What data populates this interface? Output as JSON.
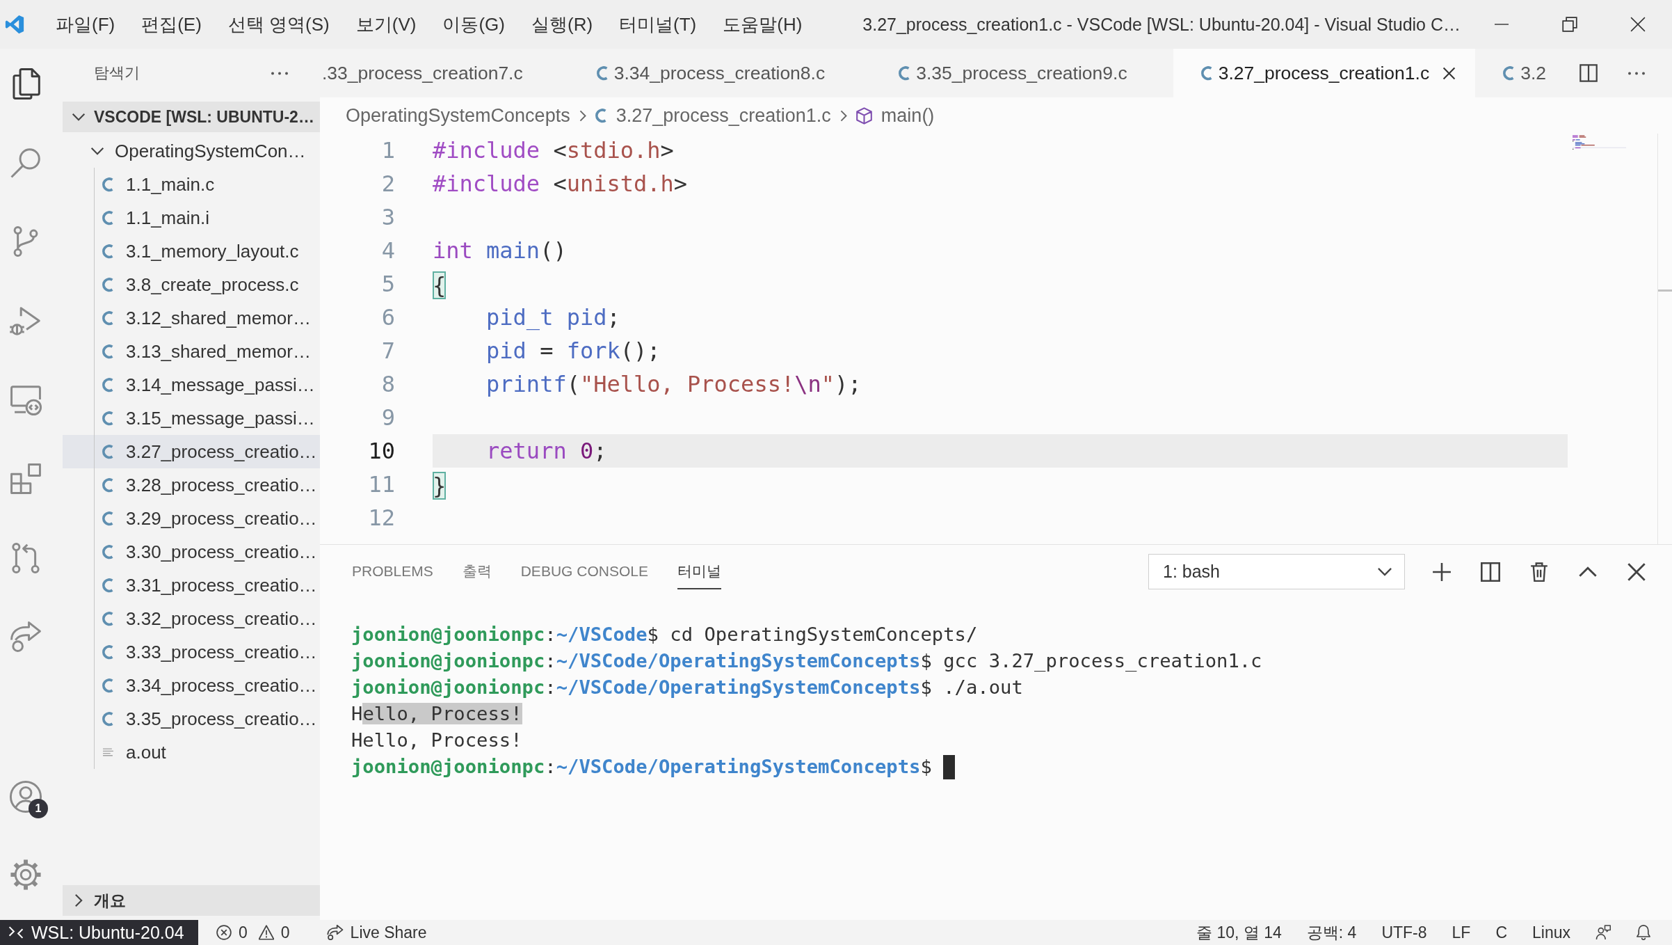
{
  "window": {
    "title": "3.27_process_creation1.c - VSCode [WSL: Ubuntu-20.04] - Visual Studio C…"
  },
  "menu": [
    "파일(F)",
    "편집(E)",
    "선택 영역(S)",
    "보기(V)",
    "이동(G)",
    "실행(R)",
    "터미널(T)",
    "도움말(H)"
  ],
  "activity_bar": {
    "items": [
      {
        "kind": "explorer",
        "selected": true
      },
      {
        "kind": "search",
        "selected": false
      },
      {
        "kind": "source_control",
        "selected": false
      },
      {
        "kind": "run_debug",
        "selected": false
      },
      {
        "kind": "remote",
        "selected": false
      },
      {
        "kind": "extensions",
        "selected": false
      },
      {
        "kind": "pull_requests",
        "selected": false
      },
      {
        "kind": "live_share",
        "selected": false
      }
    ],
    "bottom": [
      {
        "kind": "accounts",
        "badge": "1"
      },
      {
        "kind": "settings"
      }
    ]
  },
  "sidebar": {
    "title": "탐색기",
    "sections": [
      {
        "title": "VSCODE [WSL: UBUNTU-2…",
        "expanded": true,
        "children": [
          {
            "name": "OperatingSystemCon…",
            "kind": "folder",
            "expanded": true,
            "selected": false,
            "children": [
              {
                "name": "1.1_main.c",
                "kind": "c",
                "selected": false
              },
              {
                "name": "1.1_main.i",
                "kind": "c",
                "selected": false
              },
              {
                "name": "3.1_memory_layout.c",
                "kind": "c",
                "selected": false
              },
              {
                "name": "3.8_create_process.c",
                "kind": "c",
                "selected": false
              },
              {
                "name": "3.12_shared_memor…",
                "kind": "c",
                "selected": false
              },
              {
                "name": "3.13_shared_memor…",
                "kind": "c",
                "selected": false
              },
              {
                "name": "3.14_message_passi…",
                "kind": "c",
                "selected": false
              },
              {
                "name": "3.15_message_passi…",
                "kind": "c",
                "selected": false
              },
              {
                "name": "3.27_process_creatio…",
                "kind": "c",
                "selected": true
              },
              {
                "name": "3.28_process_creatio…",
                "kind": "c",
                "selected": false
              },
              {
                "name": "3.29_process_creatio…",
                "kind": "c",
                "selected": false
              },
              {
                "name": "3.30_process_creatio…",
                "kind": "c",
                "selected": false
              },
              {
                "name": "3.31_process_creatio…",
                "kind": "c",
                "selected": false
              },
              {
                "name": "3.32_process_creatio…",
                "kind": "c",
                "selected": false
              },
              {
                "name": "3.33_process_creatio…",
                "kind": "c",
                "selected": false
              },
              {
                "name": "3.34_process_creatio…",
                "kind": "c",
                "selected": false
              },
              {
                "name": "3.35_process_creatio…",
                "kind": "c",
                "selected": false
              },
              {
                "name": "a.out",
                "kind": "file",
                "selected": false
              }
            ]
          }
        ]
      },
      {
        "title": "개요",
        "expanded": false
      }
    ]
  },
  "editor": {
    "tabs": [
      {
        "label": ".33_process_creation7.c",
        "kind": "clipped",
        "selected": false
      },
      {
        "label": "3.34_process_creation8.c",
        "kind": "c",
        "selected": false
      },
      {
        "label": "3.35_process_creation9.c",
        "kind": "c",
        "selected": false
      },
      {
        "label": "3.27_process_creation1.c",
        "kind": "c",
        "selected": true
      },
      {
        "label": "3.2",
        "kind": "c",
        "selected": false
      }
    ],
    "breadcrumb": [
      {
        "text": "OperatingSystemConcepts",
        "kind": "folder"
      },
      {
        "text": "3.27_process_creation1.c",
        "kind": "c"
      },
      {
        "text": "main()",
        "kind": "symbol"
      }
    ],
    "lines": [
      {
        "number": "1",
        "current": false,
        "tokens": [
          {
            "kind": "directive",
            "text": "#include"
          },
          {
            "kind": "plain",
            "text": " <"
          },
          {
            "kind": "header",
            "text": "stdio.h"
          },
          {
            "kind": "plain",
            "text": ">"
          }
        ]
      },
      {
        "number": "2",
        "current": false,
        "tokens": [
          {
            "kind": "directive",
            "text": "#include"
          },
          {
            "kind": "plain",
            "text": " <"
          },
          {
            "kind": "header",
            "text": "unistd.h"
          },
          {
            "kind": "plain",
            "text": ">"
          }
        ]
      },
      {
        "number": "3",
        "current": false
      },
      {
        "number": "4",
        "current": false,
        "tokens": [
          {
            "kind": "keyword",
            "text": "int"
          },
          {
            "kind": "function",
            "text": " main"
          },
          {
            "kind": "plain",
            "text": "()"
          }
        ]
      },
      {
        "number": "5",
        "current": false,
        "tokens": [
          {
            "kind": "bracket_match",
            "text": "{"
          }
        ]
      },
      {
        "number": "6",
        "current": false,
        "tokens": [
          {
            "kind": "type",
            "text": "    pid_t"
          },
          {
            "kind": "variable",
            "text": " pid"
          },
          {
            "kind": "plain",
            "text": ";"
          }
        ]
      },
      {
        "number": "7",
        "current": false,
        "tokens": [
          {
            "kind": "variable",
            "text": "    pid"
          },
          {
            "kind": "plain",
            "text": " = "
          },
          {
            "kind": "function",
            "text": "fork"
          },
          {
            "kind": "plain",
            "text": "();"
          }
        ]
      },
      {
        "number": "8",
        "current": false,
        "tokens": [
          {
            "kind": "function",
            "text": "    printf"
          },
          {
            "kind": "plain",
            "text": "("
          },
          {
            "kind": "string",
            "text": "\"Hello, Process!"
          },
          {
            "kind": "escape",
            "text": "\\n"
          },
          {
            "kind": "string",
            "text": "\""
          },
          {
            "kind": "plain",
            "text": ");"
          }
        ]
      },
      {
        "number": "9",
        "current": false
      },
      {
        "number": "10",
        "current": true,
        "tokens": [
          {
            "kind": "keyword",
            "text": "    return"
          },
          {
            "kind": "number",
            "text": " 0"
          },
          {
            "kind": "plain",
            "text": ";"
          }
        ]
      },
      {
        "number": "11",
        "current": false,
        "tokens": [
          {
            "kind": "bracket_match",
            "text": "}"
          }
        ]
      },
      {
        "number": "12",
        "current": false
      }
    ]
  },
  "panel": {
    "tabs": [
      {
        "label": "PROBLEMS",
        "selected": false
      },
      {
        "label": "출력",
        "selected": false
      },
      {
        "label": "DEBUG CONSOLE",
        "selected": false
      },
      {
        "label": "터미널",
        "selected": true
      }
    ],
    "terminal_picker": "1: bash",
    "terminal": [
      {
        "cursor": false,
        "segments": [
          {
            "kind": "user",
            "text": "joonion@joonionpc"
          },
          {
            "kind": "plain",
            "text": ":"
          },
          {
            "kind": "path",
            "text": "~/VSCode"
          },
          {
            "kind": "plain",
            "text": "$ cd OperatingSystemConcepts/"
          }
        ]
      },
      {
        "cursor": false,
        "segments": [
          {
            "kind": "user",
            "text": "joonion@joonionpc"
          },
          {
            "kind": "plain",
            "text": ":"
          },
          {
            "kind": "path",
            "text": "~/VSCode/OperatingSystemConcepts"
          },
          {
            "kind": "plain",
            "text": "$ gcc 3.27_process_creation1.c"
          }
        ]
      },
      {
        "cursor": false,
        "segments": [
          {
            "kind": "user",
            "text": "joonion@joonionpc"
          },
          {
            "kind": "plain",
            "text": ":"
          },
          {
            "kind": "path",
            "text": "~/VSCode/OperatingSystemConcepts"
          },
          {
            "kind": "plain",
            "text": "$ ./a.out"
          }
        ]
      },
      {
        "cursor": false,
        "segments": [
          {
            "kind": "plain",
            "text": "H"
          },
          {
            "kind": "selection",
            "text": "ello, Process!"
          }
        ]
      },
      {
        "cursor": false,
        "segments": [
          {
            "kind": "plain",
            "text": "Hello, Process!"
          }
        ]
      },
      {
        "cursor": true,
        "segments": [
          {
            "kind": "user",
            "text": "joonion@joonionpc"
          },
          {
            "kind": "plain",
            "text": ":"
          },
          {
            "kind": "path",
            "text": "~/VSCode/OperatingSystemConcepts"
          },
          {
            "kind": "plain",
            "text": "$"
          }
        ]
      }
    ]
  },
  "status_bar": {
    "remote": "WSL: Ubuntu-20.04",
    "errors": "0",
    "warnings": "0",
    "live_share": "Live Share",
    "items": [
      "줄 10, 열 14",
      "공백: 4",
      "UTF-8",
      "LF",
      "C",
      "Linux"
    ]
  }
}
